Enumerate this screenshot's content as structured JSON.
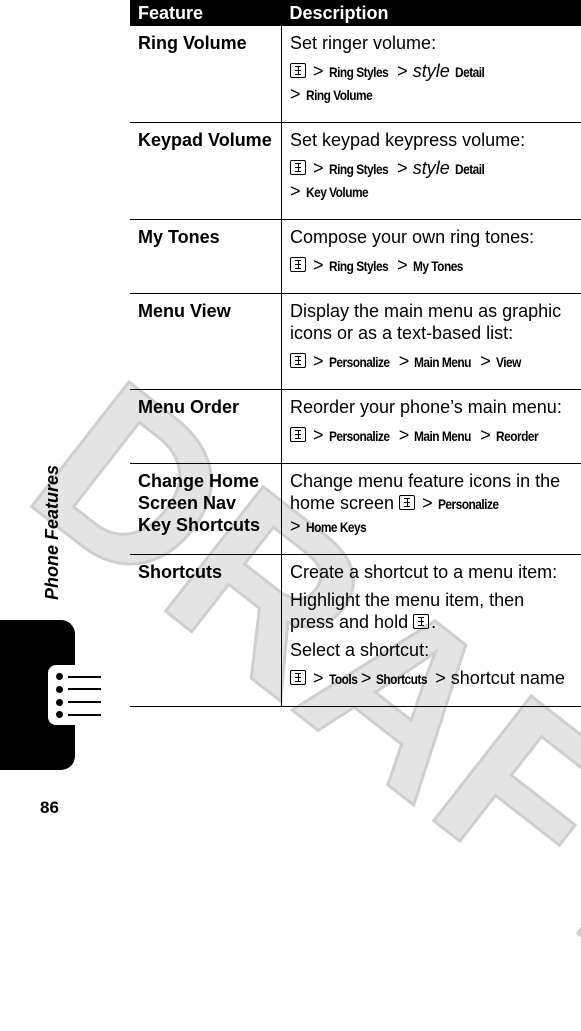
{
  "watermark": "DRAFT",
  "table": {
    "headers": [
      "Feature",
      "Description"
    ],
    "rows": [
      {
        "feature": "Ring Volume",
        "lines": [
          [
            {
              "s": "n",
              "t": "Set ringer volume:"
            }
          ],
          [
            {
              "s": "key",
              "t": ""
            },
            {
              "s": "n",
              "t": " > "
            },
            {
              "s": "b",
              "t": "Ring Styles"
            },
            {
              "s": "n",
              "t": " > "
            },
            {
              "s": "i",
              "t": "style"
            },
            {
              "s": "n",
              "t": " "
            },
            {
              "s": "b",
              "t": "Detail"
            },
            {
              "s": "br",
              "t": ""
            },
            {
              "s": "n",
              "t": "> "
            },
            {
              "s": "b",
              "t": "Ring Volume"
            }
          ]
        ]
      },
      {
        "feature": "Keypad Volume",
        "lines": [
          [
            {
              "s": "n",
              "t": "Set keypad keypress volume:"
            }
          ],
          [
            {
              "s": "key",
              "t": ""
            },
            {
              "s": "n",
              "t": " > "
            },
            {
              "s": "b",
              "t": "Ring Styles"
            },
            {
              "s": "n",
              "t": " > "
            },
            {
              "s": "i",
              "t": "style"
            },
            {
              "s": "n",
              "t": " "
            },
            {
              "s": "b",
              "t": "Detail"
            },
            {
              "s": "br",
              "t": ""
            },
            {
              "s": "n",
              "t": "> "
            },
            {
              "s": "b",
              "t": "Key Volume"
            }
          ]
        ]
      },
      {
        "feature": "My Tones",
        "lines": [
          [
            {
              "s": "n",
              "t": "Compose your own ring tones:"
            }
          ],
          [
            {
              "s": "key",
              "t": ""
            },
            {
              "s": "n",
              "t": " > "
            },
            {
              "s": "b",
              "t": "Ring Styles"
            },
            {
              "s": "n",
              "t": " > "
            },
            {
              "s": "b",
              "t": "My Tones"
            }
          ]
        ]
      },
      {
        "feature": "Menu View",
        "lines": [
          [
            {
              "s": "n",
              "t": "Display the main menu as graphic icons or as a text-based list:"
            }
          ],
          [
            {
              "s": "key",
              "t": ""
            },
            {
              "s": "n",
              "t": " > "
            },
            {
              "s": "b",
              "t": "Personalize"
            },
            {
              "s": "n",
              "t": " > "
            },
            {
              "s": "b",
              "t": "Main Menu"
            },
            {
              "s": "n",
              "t": " > "
            },
            {
              "s": "b",
              "t": "View"
            }
          ]
        ]
      },
      {
        "feature": "Menu Order",
        "lines": [
          [
            {
              "s": "n",
              "t": "Reorder your phone’s main menu:"
            }
          ],
          [
            {
              "s": "key",
              "t": ""
            },
            {
              "s": "n",
              "t": " > "
            },
            {
              "s": "b",
              "t": "Personalize"
            },
            {
              "s": "n",
              "t": " > "
            },
            {
              "s": "b",
              "t": "Main Menu"
            },
            {
              "s": "n",
              "t": " > "
            },
            {
              "s": "b",
              "t": "Reorder"
            }
          ]
        ]
      },
      {
        "feature": "Change Home Screen Nav Key Shortcuts",
        "lines": [
          [
            {
              "s": "n",
              "t": "Change menu feature icons in the home screen "
            },
            {
              "s": "key",
              "t": ""
            },
            {
              "s": "n",
              "t": " > "
            },
            {
              "s": "b",
              "t": "Personalize"
            },
            {
              "s": "br",
              "t": ""
            },
            {
              "s": "n",
              "t": "> "
            },
            {
              "s": "b",
              "t": "Home Keys"
            }
          ]
        ]
      },
      {
        "feature": "Shortcuts",
        "lines": [
          [
            {
              "s": "n",
              "t": "Create a shortcut to a menu item:"
            }
          ],
          [
            {
              "s": "n",
              "t": "Highlight the menu item, then press and hold "
            },
            {
              "s": "key",
              "t": ""
            },
            {
              "s": "n",
              "t": "."
            }
          ],
          [
            {
              "s": "n",
              "t": "Select a shortcut:"
            }
          ],
          [
            {
              "s": "key",
              "t": ""
            },
            {
              "s": "n",
              "t": " > "
            },
            {
              "s": "b",
              "t": "Tools"
            },
            {
              "s": "n",
              "t": " > "
            },
            {
              "s": "b",
              "t": "Shortcuts"
            },
            {
              "s": "n",
              "t": " > shortcut name"
            }
          ]
        ]
      }
    ]
  },
  "side_label": "Phone Features",
  "tab_icon": "menu-list-icon",
  "page_number": "86"
}
